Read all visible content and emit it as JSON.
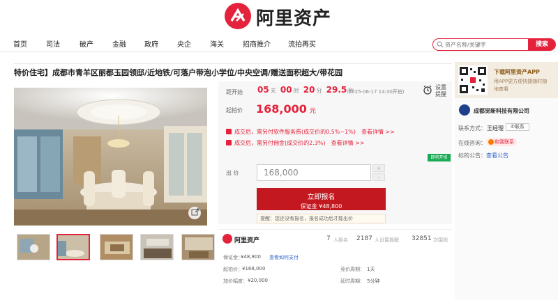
{
  "brand": {
    "name": "阿里资产",
    "accent": "#e4223c"
  },
  "nav": {
    "items": [
      "首页",
      "司法",
      "破产",
      "金融",
      "政府",
      "央企",
      "海关",
      "招商推介",
      "流拍再买"
    ]
  },
  "search": {
    "placeholder": "资产名称/关键字",
    "button": "搜索"
  },
  "listing": {
    "title": "特价住宅】成都市青羊区丽都玉园领邸/近地铁/可落户带泡小学位/中央空调/赠送面积超大/带花园"
  },
  "countdown": {
    "label": "距开始",
    "days": "05",
    "days_unit": "天",
    "hours": "00",
    "hours_unit": "时",
    "minutes": "20",
    "minutes_unit": "分",
    "seconds": "29.5",
    "seconds_unit": "秒",
    "start_text": "(2025-06-17 14:30开拍)"
  },
  "remind": {
    "line1": "设置",
    "line2": "提醒"
  },
  "start_price": {
    "label": "起拍价",
    "value": "168,000",
    "unit": "元"
  },
  "fees": [
    {
      "text": "成交后，需另付软件服务费(成交价的0.5%~1%)",
      "link": "查看详情 >>"
    },
    {
      "text": "成交后，需另付佣金(成交价的2.3%)",
      "link": "查看详情 >>"
    }
  ],
  "soon_tag": "即将开拍",
  "bid": {
    "label": "出 价",
    "value": "168,000",
    "plus": "+",
    "minus": "-"
  },
  "signup": {
    "label": "立即报名",
    "deposit": "保证金 ¥48,800"
  },
  "tip": "提醒：您还没有报名，报名成功后才能出价",
  "stats": {
    "platform": "阿里资产",
    "signups": "7",
    "signups_label": "人报名",
    "reminders": "2187",
    "reminders_label": "人设置提醒",
    "views": "32851",
    "views_label": "次围观"
  },
  "details": {
    "deposit_label": "保证金：",
    "deposit_value": "¥48,800",
    "deposit_link": "查看如何支付",
    "start_label": "起拍价：",
    "start_value": "¥168,000",
    "step_label": "加价幅度：",
    "step_value": "¥20,000",
    "cycle_label": "竞价周期：",
    "cycle_value": "1天",
    "delay_label": "延时周期：",
    "delay_value": "5分钟"
  },
  "sidebar": {
    "app_title": "下载阿里资产APP",
    "app_sub": "用APP更方便快捷随时随地查看",
    "company": "成都觉新科技有限公司",
    "contact_label": "联系方式：",
    "contact_name": "王经理",
    "contact_btn": "联系",
    "online_label": "在线咨询：",
    "online_btn": "和我联系",
    "notice_label": "标的公告：",
    "notice_link": "查看公告"
  }
}
